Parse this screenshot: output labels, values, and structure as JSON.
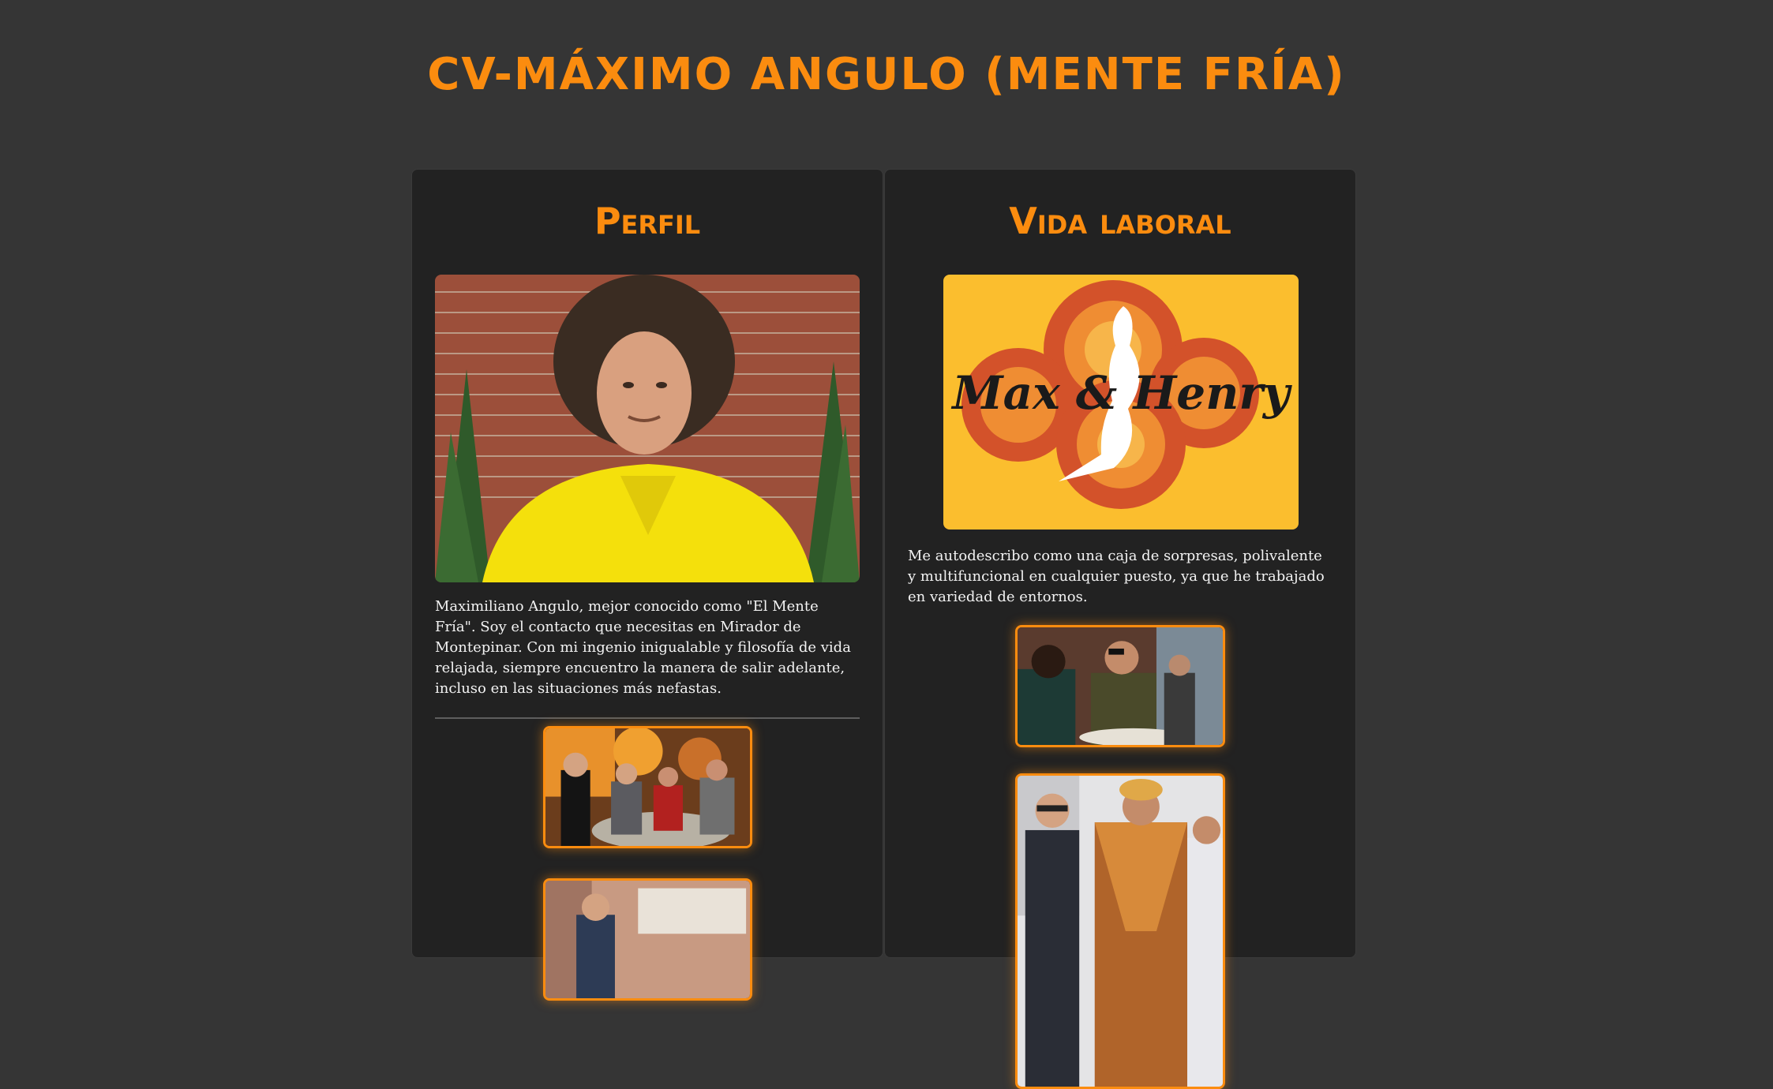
{
  "page": {
    "title": "CV-MÁXIMO ANGULO (MENTE FRÍA)"
  },
  "perfil": {
    "heading": "Perfil",
    "description": "Maximiliano Angulo, mejor conocido como \"El Mente Fría\". Soy el contacto que necesitas en Mirador de Montepinar. Con mi ingenio inigualable y filosofía de vida relajada, siempre encuentro la manera de salir adelante, incluso en las situaciones más nefastas."
  },
  "vida_laboral": {
    "heading": "Vida laboral",
    "logo_text": "Max & Henry",
    "description": "Me autodescribo como una caja de sorpresas, polivalente y multifuncional en cualquier puesto, ya que he trabajado en variedad de entornos."
  },
  "colors": {
    "accent": "#fb8c0f",
    "background": "#353535",
    "panel": "#222222",
    "text": "#f3f3f3"
  }
}
